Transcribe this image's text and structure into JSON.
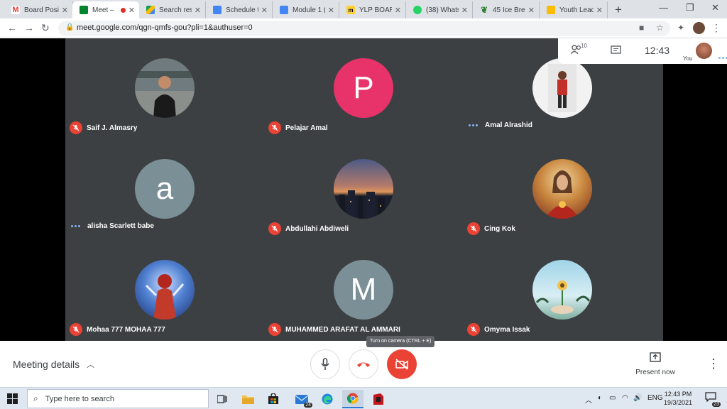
{
  "browser": {
    "tabs": [
      {
        "title": "Board Positi",
        "favicon": "gmail-icon",
        "color": "#ea4335"
      },
      {
        "title": "Meet –",
        "favicon": "meet-icon",
        "color": "#00832d",
        "active": true,
        "recording": true
      },
      {
        "title": "Search resu",
        "favicon": "drive-icon",
        "color": "#fbbc04"
      },
      {
        "title": "Schedule tr",
        "favicon": "docs-icon",
        "color": "#4285f4"
      },
      {
        "title": "Module 1 (",
        "favicon": "docs-icon",
        "color": "#4285f4"
      },
      {
        "title": "YLP BOARD",
        "favicon": "miro-icon",
        "color": "#ffd02f"
      },
      {
        "title": "(38) Whats",
        "favicon": "whatsapp-icon",
        "color": "#25d366"
      },
      {
        "title": "45 Ice Brea",
        "favicon": "leaf-icon",
        "color": "#2e7d32"
      },
      {
        "title": "Youth Leade",
        "favicon": "slides-icon",
        "color": "#fbbc04"
      }
    ],
    "url": "meet.google.com/qgn-qmfs-gou?pli=1&authuser=0"
  },
  "meet": {
    "participants_count": "10",
    "clock": "12:43",
    "you_label": "You",
    "participants": [
      {
        "name": "Saif J. Almasry",
        "status": "muted",
        "avatar": "photo",
        "photo": "man-in-room"
      },
      {
        "name": "Pelajar Amal",
        "status": "muted",
        "avatar": "letter",
        "letter": "P",
        "color": "#e8336a"
      },
      {
        "name": "Amal Alrashid",
        "status": "speaking",
        "avatar": "photo",
        "photo": "person-red"
      },
      {
        "name": "alisha Scarlett babe",
        "status": "speaking",
        "avatar": "letter",
        "letter": "a",
        "color": "#7b8f96"
      },
      {
        "name": "Abdullahi Abdiweli",
        "status": "muted",
        "avatar": "photo",
        "photo": "city-sunset"
      },
      {
        "name": "Cing Kok",
        "status": "muted",
        "avatar": "photo",
        "photo": "portrait-red"
      },
      {
        "name": "Mohaa 777 MOHAA 777",
        "status": "muted",
        "avatar": "photo",
        "photo": "blue-hero"
      },
      {
        "name": "MUHAMMED ARAFAT AL AMMARI",
        "status": "muted",
        "avatar": "letter",
        "letter": "M",
        "color": "#7b8f96"
      },
      {
        "name": "Omyma Issak",
        "status": "muted",
        "avatar": "photo",
        "photo": "flower-sky"
      }
    ],
    "meeting_details_label": "Meeting details",
    "tooltip": "Turn on camera (CTRL + E)",
    "present_label": "Present now"
  },
  "taskbar": {
    "search_placeholder": "Type here to search",
    "mail_badge": "24",
    "lang": "ENG",
    "time": "12:43 PM",
    "date": "19/3/2021",
    "notifications": "23"
  }
}
